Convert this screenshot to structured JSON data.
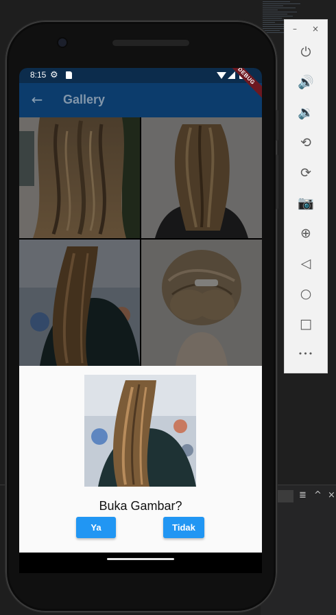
{
  "status_bar": {
    "time": "8:15"
  },
  "app_bar": {
    "title": "Gallery",
    "debug_banner": "DEBUG"
  },
  "dialog": {
    "question": "Buka Gambar?",
    "yes_label": "Ya",
    "no_label": "Tidak"
  },
  "emulator_toolbar": {
    "window_controls": {
      "minimize": "–",
      "close": "×"
    },
    "tools": [
      {
        "name": "power-icon",
        "glyph": "⏻"
      },
      {
        "name": "volume-up-icon",
        "glyph": "🔊"
      },
      {
        "name": "volume-down-icon",
        "glyph": "🔉"
      },
      {
        "name": "rotate-left-icon",
        "glyph": "⟲"
      },
      {
        "name": "rotate-right-icon",
        "glyph": "⟳"
      },
      {
        "name": "camera-icon",
        "glyph": "📷"
      },
      {
        "name": "zoom-icon",
        "glyph": "⊕"
      },
      {
        "name": "back-icon",
        "glyph": "◁"
      },
      {
        "name": "home-icon",
        "glyph": "○"
      },
      {
        "name": "overview-icon",
        "glyph": "□"
      },
      {
        "name": "more-icon",
        "glyph": "•••"
      }
    ]
  },
  "ide_controls": {
    "menu": "≣",
    "collapse": "^",
    "close": "×"
  },
  "colors": {
    "app_bar": "#0c3c6c",
    "button": "#2196f3",
    "debug": "#6d1820"
  }
}
